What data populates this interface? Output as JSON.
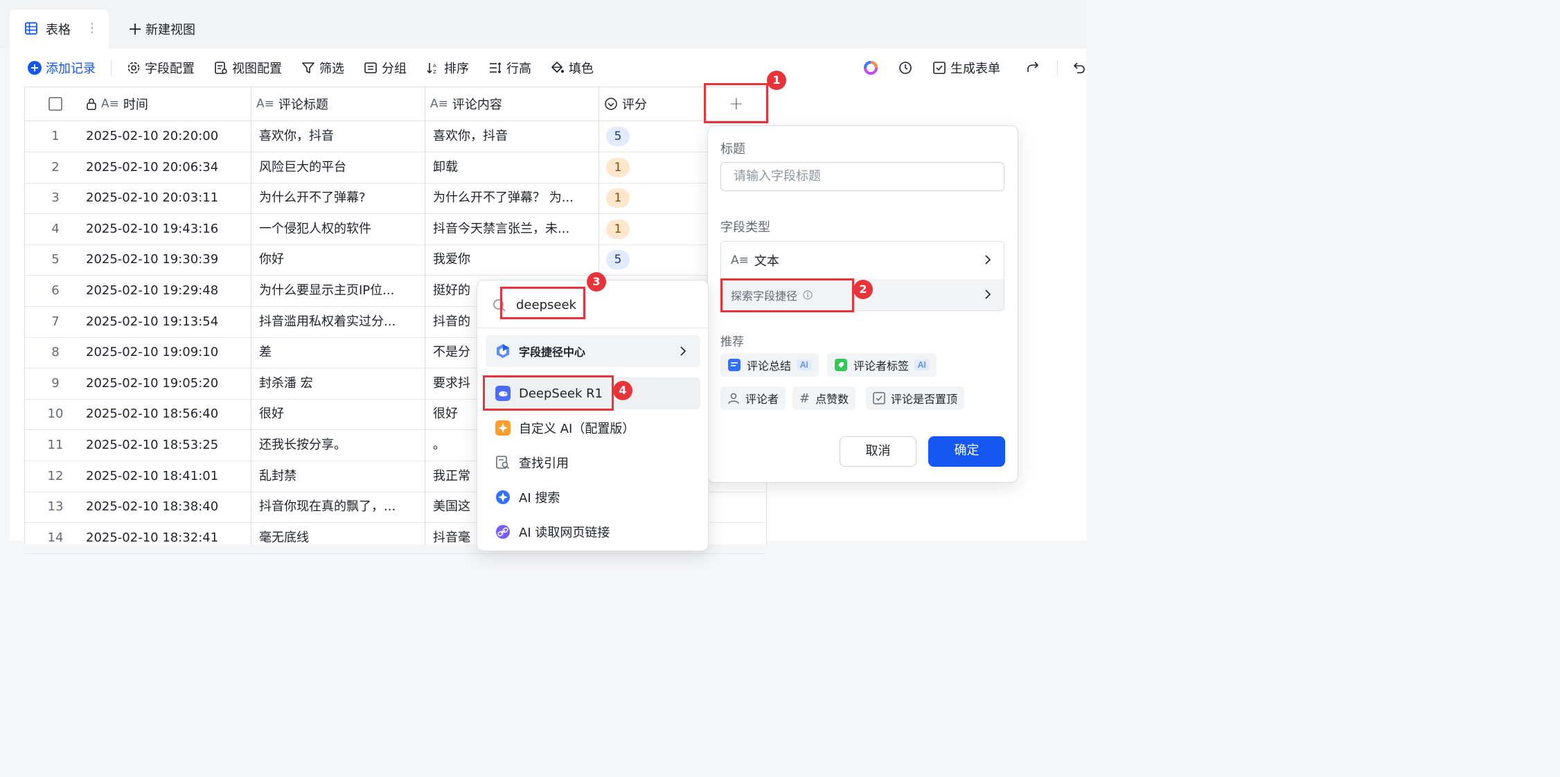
{
  "tabs": {
    "active_label": "表格",
    "more": "⋮",
    "new_view": "新建视图"
  },
  "toolbar": {
    "add_record": "添加记录",
    "field_config": "字段配置",
    "view_config": "视图配置",
    "filter": "筛选",
    "group": "分组",
    "sort": "排序",
    "row_height": "行高",
    "fill_color": "填色",
    "generate_form": "生成表单"
  },
  "columns": {
    "time": "时间",
    "title": "评论标题",
    "content": "评论内容",
    "score": "评分",
    "add": "+"
  },
  "rows": [
    {
      "n": "1",
      "time": "2025-02-10 20:20:00",
      "title": "喜欢你，抖音",
      "content": "喜欢你，抖音",
      "score": "5"
    },
    {
      "n": "2",
      "time": "2025-02-10 20:06:34",
      "title": "风险巨大的平台",
      "content": "卸载",
      "score": "1"
    },
    {
      "n": "3",
      "time": "2025-02-10 20:03:11",
      "title": "为什么开不了弹幕?",
      "content": "为什么开不了弹幕？ 为...",
      "score": "1"
    },
    {
      "n": "4",
      "time": "2025-02-10 19:43:16",
      "title": "一个侵犯人权的软件",
      "content": "抖音今天禁言张兰，未...",
      "score": "1"
    },
    {
      "n": "5",
      "time": "2025-02-10 19:30:39",
      "title": "你好",
      "content": "我爱你",
      "score": "5"
    },
    {
      "n": "6",
      "time": "2025-02-10 19:29:48",
      "title": "为什么要显示主页IP位...",
      "content": "挺好的",
      "score": ""
    },
    {
      "n": "7",
      "time": "2025-02-10 19:13:54",
      "title": "抖音滥用私权着实过分...",
      "content": "抖音的",
      "score": ""
    },
    {
      "n": "8",
      "time": "2025-02-10 19:09:10",
      "title": "差",
      "content": "不是分",
      "score": ""
    },
    {
      "n": "9",
      "time": "2025-02-10 19:05:20",
      "title": "封杀潘 宏",
      "content": "要求抖",
      "score": ""
    },
    {
      "n": "10",
      "time": "2025-02-10 18:56:40",
      "title": "很好",
      "content": "很好",
      "score": ""
    },
    {
      "n": "11",
      "time": "2025-02-10 18:53:25",
      "title": "还我长按分享。",
      "content": "。",
      "score": ""
    },
    {
      "n": "12",
      "time": "2025-02-10 18:41:01",
      "title": "乱封禁",
      "content": "我正常",
      "score": ""
    },
    {
      "n": "13",
      "time": "2025-02-10 18:38:40",
      "title": "抖音你现在真的飘了，...",
      "content": "美国这",
      "score": ""
    },
    {
      "n": "14",
      "time": "2025-02-10 18:32:41",
      "title": "毫无底线",
      "content": "抖音毫",
      "score": ""
    }
  ],
  "panel": {
    "title_label": "标题",
    "title_placeholder": "请输入字段标题",
    "type_label": "字段类型",
    "type_value": "文本",
    "explore": "探索字段捷径",
    "recommend_label": "推荐",
    "rec": [
      "评论总结",
      "评论者标签",
      "评论者",
      "点赞数",
      "评论是否置顶"
    ],
    "ai_tag": "AI",
    "cancel": "取消",
    "confirm": "确定"
  },
  "dropdown": {
    "search_value": "deepseek",
    "center": "字段捷径中心",
    "items": [
      "DeepSeek R1",
      "自定义 AI（配置版）",
      "查找引用",
      "AI 搜索",
      "AI 读取网页链接"
    ]
  },
  "annotations": [
    "1",
    "2",
    "3",
    "4"
  ],
  "colors": {
    "accent": "#1456f0",
    "annotation": "#e8333a",
    "badge_high_bg": "#e1eaff",
    "badge_low_bg": "#fee7cd"
  }
}
